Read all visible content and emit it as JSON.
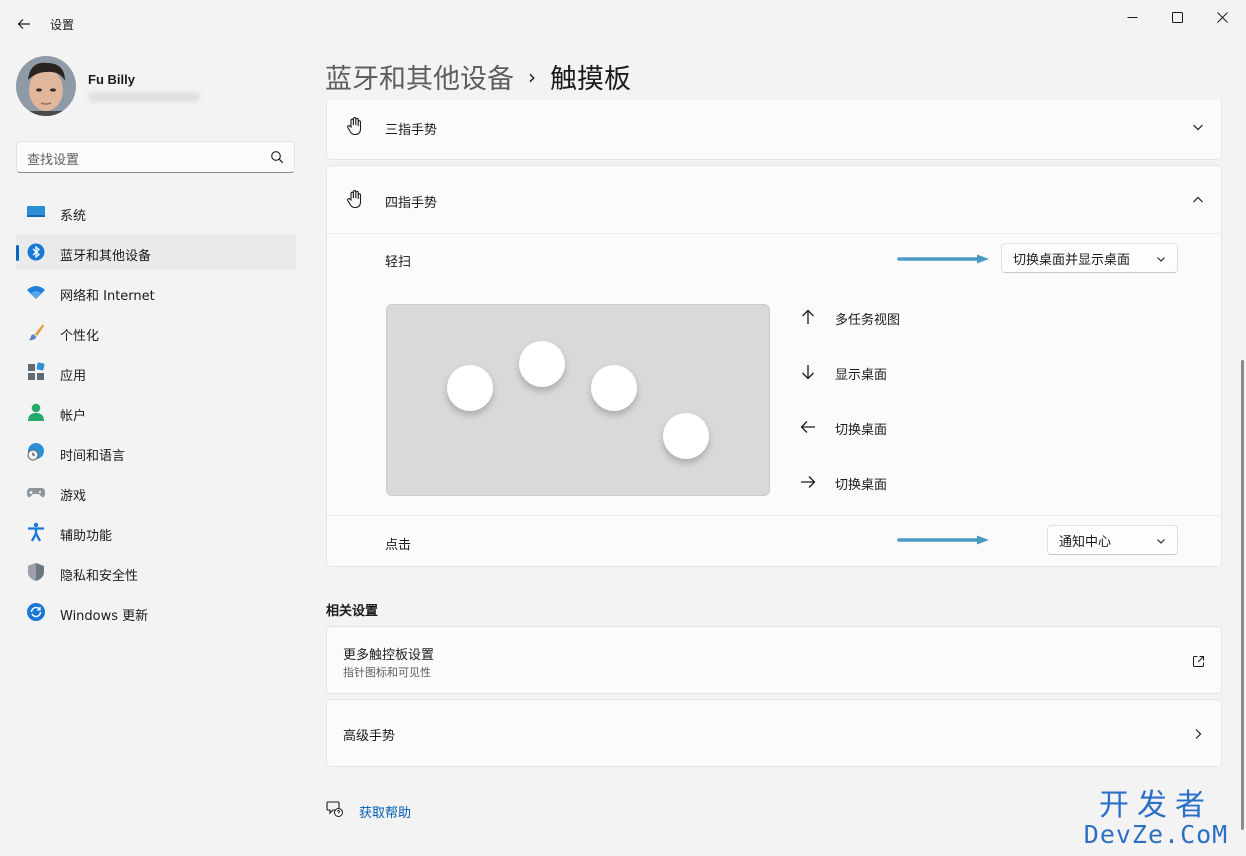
{
  "app": {
    "title": "设置"
  },
  "profile": {
    "name": "Fu Billy"
  },
  "search": {
    "placeholder": "查找设置"
  },
  "sidebar": {
    "items": [
      {
        "label": "系统",
        "icon": "monitor-icon"
      },
      {
        "label": "蓝牙和其他设备",
        "icon": "bluetooth-icon",
        "active": true
      },
      {
        "label": "网络和 Internet",
        "icon": "wifi-icon"
      },
      {
        "label": "个性化",
        "icon": "paintbrush-icon"
      },
      {
        "label": "应用",
        "icon": "apps-icon"
      },
      {
        "label": "帐户",
        "icon": "person-icon"
      },
      {
        "label": "时间和语言",
        "icon": "globe-clock-icon"
      },
      {
        "label": "游戏",
        "icon": "gamepad-icon"
      },
      {
        "label": "辅助功能",
        "icon": "accessibility-icon"
      },
      {
        "label": "隐私和安全性",
        "icon": "shield-icon"
      },
      {
        "label": "Windows 更新",
        "icon": "update-icon"
      }
    ]
  },
  "breadcrumb": {
    "parent": "蓝牙和其他设备",
    "separator": "›",
    "current": "触摸板"
  },
  "three_finger": {
    "label": "三指手势",
    "expanded": false
  },
  "four_finger": {
    "label": "四指手势",
    "expanded": true,
    "swipe": {
      "label": "轻扫",
      "value": "切换桌面并显示桌面"
    },
    "gestures": [
      {
        "direction": "up",
        "label": "多任务视图"
      },
      {
        "direction": "down",
        "label": "显示桌面"
      },
      {
        "direction": "left",
        "label": "切换桌面"
      },
      {
        "direction": "right",
        "label": "切换桌面"
      }
    ],
    "tap": {
      "label": "点击",
      "value": "通知中心"
    }
  },
  "related": {
    "title": "相关设置",
    "more_touchpad": {
      "title": "更多触控板设置",
      "subtitle": "指针图标和可见性"
    },
    "advanced": {
      "title": "高级手势"
    }
  },
  "help": {
    "label": "获取帮助"
  },
  "watermark": {
    "cn": "开发者",
    "en": "DevZe.CoM"
  },
  "colors": {
    "accent": "#0067c0",
    "annotation_arrow": "#4a9ac4",
    "watermark": "#2c6fc4"
  }
}
